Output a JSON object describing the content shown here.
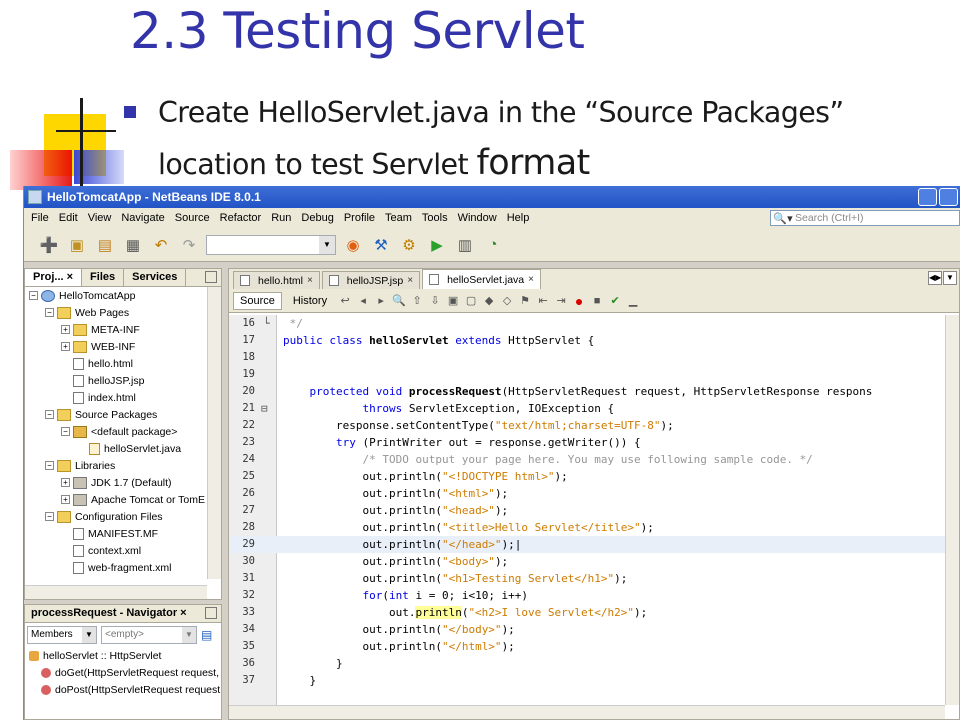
{
  "slide": {
    "title": "2.3 Testing Servlet",
    "bullet_main": "Create HelloServlet.java in the “Source Packages” location to test Servlet ",
    "bullet_tail": "format"
  },
  "window": {
    "title": "HelloTomcatApp - NetBeans IDE 8.0.1"
  },
  "menu": [
    "File",
    "Edit",
    "View",
    "Navigate",
    "Source",
    "Refactor",
    "Run",
    "Debug",
    "Profile",
    "Team",
    "Tools",
    "Window",
    "Help"
  ],
  "search": {
    "placeholder": "Search (Ctrl+I)"
  },
  "toolbar_icons": [
    "new-file-icon",
    "new-project-icon",
    "open-project-icon",
    "save-all-icon",
    "undo-icon",
    "redo-icon",
    "browser-icon",
    "clean-build-icon",
    "build-icon",
    "run-icon",
    "debug-icon",
    "profile-icon"
  ],
  "projects_pane": {
    "tabs": [
      "Proj... ×",
      "Files",
      "Services"
    ],
    "tree": [
      {
        "level": 0,
        "exp": "−",
        "icon": "globe",
        "label": "HelloTomcatApp"
      },
      {
        "level": 1,
        "exp": "−",
        "icon": "folder",
        "label": "Web Pages"
      },
      {
        "level": 2,
        "exp": "+",
        "icon": "folder",
        "label": "META-INF"
      },
      {
        "level": 2,
        "exp": "+",
        "icon": "folder",
        "label": "WEB-INF"
      },
      {
        "level": 2,
        "exp": "",
        "icon": "file",
        "label": "hello.html"
      },
      {
        "level": 2,
        "exp": "",
        "icon": "file",
        "label": "helloJSP.jsp"
      },
      {
        "level": 2,
        "exp": "",
        "icon": "file",
        "label": "index.html"
      },
      {
        "level": 1,
        "exp": "−",
        "icon": "folder",
        "label": "Source Packages"
      },
      {
        "level": 2,
        "exp": "−",
        "icon": "pkg",
        "label": "<default package>"
      },
      {
        "level": 3,
        "exp": "",
        "icon": "java",
        "label": "helloServlet.java"
      },
      {
        "level": 1,
        "exp": "−",
        "icon": "folder",
        "label": "Libraries"
      },
      {
        "level": 2,
        "exp": "+",
        "icon": "jar",
        "label": "JDK 1.7 (Default)"
      },
      {
        "level": 2,
        "exp": "+",
        "icon": "jar",
        "label": "Apache Tomcat or TomE"
      },
      {
        "level": 1,
        "exp": "−",
        "icon": "folder",
        "label": "Configuration Files"
      },
      {
        "level": 2,
        "exp": "",
        "icon": "file",
        "label": "MANIFEST.MF"
      },
      {
        "level": 2,
        "exp": "",
        "icon": "file",
        "label": "context.xml"
      },
      {
        "level": 2,
        "exp": "",
        "icon": "file",
        "label": "web-fragment.xml"
      },
      {
        "level": 2,
        "exp": "",
        "icon": "file",
        "label": "web-fragment.xml"
      }
    ]
  },
  "navigator": {
    "title": "processRequest - Navigator ×",
    "members_combo": "Members",
    "filter_combo": "<empty>",
    "items": [
      {
        "icon": "class",
        "label": "helloServlet :: HttpServlet"
      },
      {
        "icon": "method",
        "label": "doGet(HttpServletRequest request,"
      },
      {
        "icon": "method",
        "label": "doPost(HttpServletRequest request"
      }
    ]
  },
  "editor": {
    "tabs": [
      {
        "label": "hello.html",
        "active": false
      },
      {
        "label": "helloJSP.jsp",
        "active": false
      },
      {
        "label": "helloServlet.java",
        "active": true
      }
    ],
    "view_tabs": [
      "Source",
      "History"
    ],
    "highlighted_line": 29,
    "lines": [
      {
        "n": "16",
        "segs": [
          [
            "cm",
            " */"
          ]
        ]
      },
      {
        "n": "17",
        "segs": [
          [
            "kw",
            "public class "
          ],
          [
            "bd",
            "helloServlet "
          ],
          [
            "kw",
            "extends "
          ],
          [
            "",
            "HttpServlet {"
          ]
        ]
      },
      {
        "n": "18",
        "segs": [
          [
            "",
            ""
          ]
        ]
      },
      {
        "n": "19",
        "segs": [
          [
            "",
            ""
          ]
        ]
      },
      {
        "n": "20",
        "segs": [
          [
            "kw",
            "    protected void "
          ],
          [
            "bd",
            "processRequest"
          ],
          [
            "",
            "(HttpServletRequest request, HttpServletResponse respons"
          ]
        ]
      },
      {
        "n": "21",
        "segs": [
          [
            "kw",
            "            throws "
          ],
          [
            "",
            "ServletException, IOException {"
          ]
        ]
      },
      {
        "n": "22",
        "segs": [
          [
            "",
            "        response.setContentType("
          ],
          [
            "str",
            "\"text/html;charset=UTF-8\""
          ],
          [
            "",
            ");"
          ]
        ]
      },
      {
        "n": "23",
        "segs": [
          [
            "kw",
            "        try "
          ],
          [
            "",
            "(PrintWriter out = response.getWriter()) {"
          ]
        ]
      },
      {
        "n": "24",
        "segs": [
          [
            "cm",
            "            /* TODO output your page here. You may use following sample code. */"
          ]
        ]
      },
      {
        "n": "25",
        "segs": [
          [
            "",
            "            out.println("
          ],
          [
            "str",
            "\"<!DOCTYPE html>\""
          ],
          [
            "",
            ");"
          ]
        ]
      },
      {
        "n": "26",
        "segs": [
          [
            "",
            "            out.println("
          ],
          [
            "str",
            "\"<html>\""
          ],
          [
            "",
            ");"
          ]
        ]
      },
      {
        "n": "27",
        "segs": [
          [
            "",
            "            out.println("
          ],
          [
            "str",
            "\"<head>\""
          ],
          [
            "",
            ");"
          ]
        ]
      },
      {
        "n": "28",
        "segs": [
          [
            "",
            "            out.println("
          ],
          [
            "str",
            "\"<title>Hello Servlet</title>\""
          ],
          [
            "",
            ");"
          ]
        ]
      },
      {
        "n": "29",
        "segs": [
          [
            "",
            "            out.println("
          ],
          [
            "str",
            "\"</head>\""
          ],
          [
            "",
            ");|"
          ]
        ]
      },
      {
        "n": "30",
        "segs": [
          [
            "",
            "            out.println("
          ],
          [
            "str",
            "\"<body>\""
          ],
          [
            "",
            ");"
          ]
        ]
      },
      {
        "n": "31",
        "segs": [
          [
            "",
            "            out.println("
          ],
          [
            "str",
            "\"<h1>Testing Servlet</h1>\""
          ],
          [
            "",
            ");"
          ]
        ]
      },
      {
        "n": "32",
        "segs": [
          [
            "kw",
            "            for"
          ],
          [
            "",
            "("
          ],
          [
            "kw",
            "int "
          ],
          [
            "",
            "i = 0; i<10; i++)"
          ]
        ]
      },
      {
        "n": "33",
        "segs": [
          [
            "",
            "                out."
          ],
          [
            "mark",
            "println"
          ],
          [
            "",
            "("
          ],
          [
            "str",
            "\"<h2>I love Servlet</h2>\""
          ],
          [
            "",
            ");"
          ]
        ]
      },
      {
        "n": "34",
        "segs": [
          [
            "",
            "            out.println("
          ],
          [
            "str",
            "\"</body>\""
          ],
          [
            "",
            ");"
          ]
        ]
      },
      {
        "n": "35",
        "segs": [
          [
            "",
            "            out.println("
          ],
          [
            "str",
            "\"</html>\""
          ],
          [
            "",
            ");"
          ]
        ]
      },
      {
        "n": "36",
        "segs": [
          [
            "",
            "        }"
          ]
        ]
      },
      {
        "n": "37",
        "segs": [
          [
            "",
            "    }"
          ]
        ]
      }
    ]
  }
}
